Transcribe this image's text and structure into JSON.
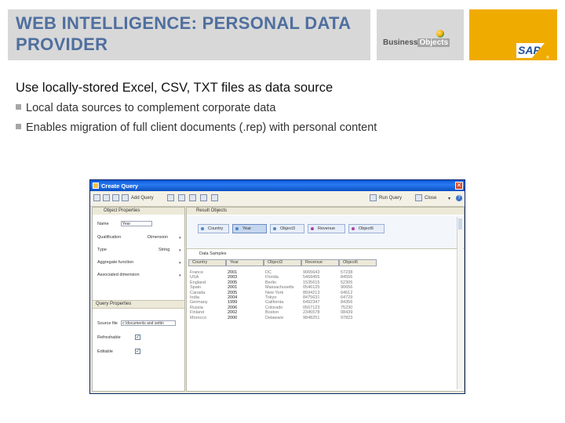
{
  "slide": {
    "title": "WEB INTELLIGENCE: PERSONAL DATA PROVIDER",
    "subheading": "Use locally-stored Excel, CSV, TXT files as data source",
    "bullets": [
      "Local data sources to complement corporate data",
      "Enables migration of full client documents (.rep) with personal content"
    ],
    "logos": {
      "business_objects": {
        "part1": "Business",
        "part2": "Objects"
      },
      "sap": "SAP",
      "sap_mark": "®"
    },
    "colors": {
      "title": "#4f6f9f",
      "header_panel": "#d8d8d8",
      "sap_gold": "#f0ab00"
    }
  },
  "window": {
    "title": "Create Query",
    "close_glyph": "✕",
    "toolbar": {
      "add_query": "Add Query",
      "run_query": "Run Query",
      "close": "Close",
      "help_glyph": "?"
    },
    "left_panel": {
      "header": "Object Properties",
      "name_label": "Name",
      "name_value": "Year",
      "qualification_label": "Qualification",
      "qualification_value": "Dimension",
      "type_label": "Type",
      "type_value": "String",
      "aggregate_label": "Aggregate function",
      "associated_label": "Associated dimension",
      "query_props_header": "Query Properties",
      "source_file_label": "Source file",
      "source_file_value": "c:\\documents and settin",
      "refreshable_label": "Refreshable",
      "refreshable_checked": true,
      "editable_label": "Editable",
      "editable_checked": true,
      "check_glyph": "✓",
      "arrow_glyph": "▾"
    },
    "right_panel": {
      "header": "Result Objects",
      "result_objects": [
        {
          "label": "Country",
          "color": "#4a86c8",
          "selected": false
        },
        {
          "label": "Year",
          "color": "#4a86c8",
          "selected": true
        },
        {
          "label": "Object3",
          "color": "#4a86c8",
          "selected": false
        },
        {
          "label": "Revenue",
          "color": "#b040a0",
          "selected": false
        },
        {
          "label": "Object6",
          "color": "#b040a0",
          "selected": false
        }
      ],
      "data_sample_label": "Data Samples",
      "columns": [
        "Country",
        "Year",
        "Object3",
        "Revenue",
        "Object6"
      ],
      "rows": [
        [
          "France",
          "2001",
          "DC",
          "9065643",
          "57238"
        ],
        [
          "USA",
          "2003",
          "Florida",
          "5468455",
          "84556"
        ],
        [
          "England",
          "2005",
          "Berlin",
          "1535615",
          "52305"
        ],
        [
          "Spain",
          "2001",
          "Massachusetts",
          "0546125",
          "90656"
        ],
        [
          "Canada",
          "2005",
          "New York",
          "8694213",
          "64612"
        ],
        [
          "India",
          "2004",
          "Tokyo",
          "8475631",
          "64729"
        ],
        [
          "Germany",
          "1999",
          "California",
          "6492347",
          "84356"
        ],
        [
          "Russia",
          "2006",
          "Colorado",
          "0567123",
          "75230"
        ],
        [
          "Finland",
          "2002",
          "Boston",
          "2345578",
          "08439"
        ],
        [
          "Morocco",
          "2000",
          "Delaware",
          "9848251",
          "97823"
        ]
      ]
    }
  }
}
